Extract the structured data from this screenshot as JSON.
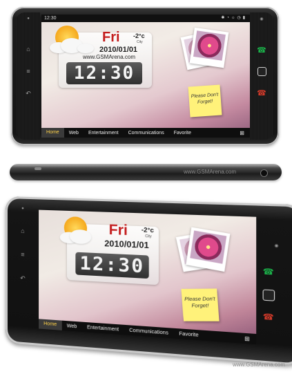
{
  "status_bar": {
    "time": "12:30"
  },
  "weather": {
    "day": "Fri",
    "temp": "-2°c",
    "temp_value": "-2",
    "temp_unit": "°c",
    "city": "City",
    "date": "2010/01/01",
    "site": "www.GSMArena.com"
  },
  "clock": {
    "time": "12:30"
  },
  "note": {
    "text": "Please Don't Forget!"
  },
  "taskbar": {
    "tabs": [
      "Home",
      "Web",
      "Entertainment",
      "Communications",
      "Favorite"
    ],
    "active": "Home"
  },
  "watermarks": {
    "side": "www.GSMArena.com",
    "bottom": "www.GSMArena.com"
  },
  "colors": {
    "day_red": "#c41e1e",
    "active_tab": "#ffd24a",
    "call_green": "#1bb24a",
    "end_red": "#d23a2a"
  },
  "icons": {
    "nav_left": [
      "home-icon",
      "menu-icon",
      "back-icon"
    ],
    "nav_right": [
      "call-icon",
      "select-square-icon",
      "end-call-icon"
    ],
    "taskbar_grid": "apps-grid-icon"
  }
}
